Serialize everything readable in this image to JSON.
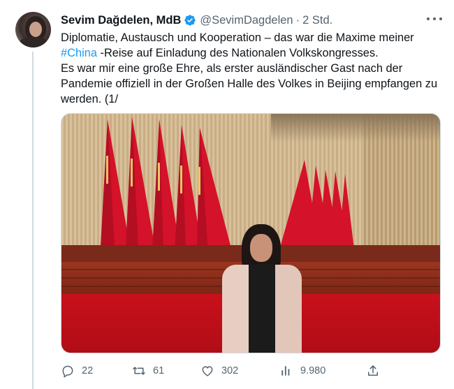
{
  "tweet": {
    "author_name": "Sevim Dağdelen, MdB",
    "handle": "@SevimDagdelen",
    "separator": "·",
    "time": "2 Std.",
    "lines": [
      {
        "before": "Diplomatie, Austausch und Kooperation – das war die Maxime meiner",
        "hashtag": "",
        "after": ""
      },
      {
        "before": "",
        "hashtag": "#China",
        "after": " -Reise auf Einladung des Nationalen Volkskongresses."
      },
      {
        "before": "Es war mir eine große Ehre, als erster ausländischer Gast nach der",
        "hashtag": "",
        "after": ""
      },
      {
        "before": "Pandemie offiziell in der Großen Halle des Volkes in Beijing empfangen zu",
        "hashtag": "",
        "after": ""
      },
      {
        "before": "werden. (1/",
        "hashtag": "",
        "after": ""
      }
    ],
    "media": {
      "icon": "photo-great-hall-of-the-people"
    },
    "actions": {
      "replies": "22",
      "retweets": "61",
      "likes": "302",
      "views": "9.980"
    },
    "icons": {
      "more": "more-options-icon",
      "verified": "verified-badge-icon",
      "reply": "reply-icon",
      "retweet": "retweet-icon",
      "like": "like-icon",
      "views": "views-icon",
      "share": "share-icon"
    },
    "colors": {
      "accent": "#1d9bf0",
      "text": "#0f1419",
      "muted": "#536471"
    }
  }
}
